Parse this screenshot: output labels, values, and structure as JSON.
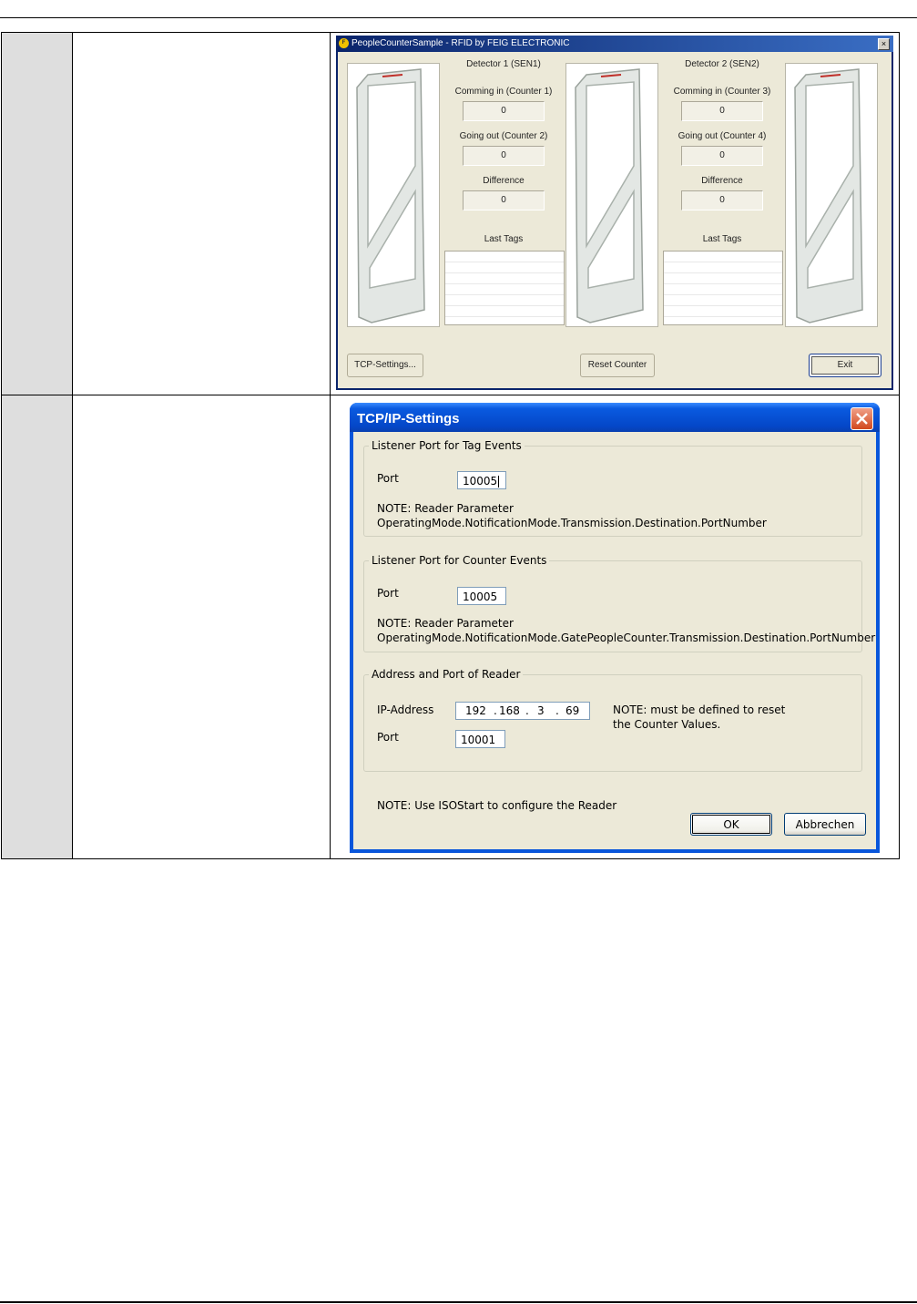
{
  "people_counter": {
    "title": "PeopleCounterSample - RFID by FEIG ELECTRONIC",
    "close_glyph": "×",
    "detectors": [
      {
        "name": "Detector 1 (SEN1)",
        "in_label": "Comming in (Counter 1)",
        "in_value": "0",
        "out_label": "Going out (Counter 2)",
        "out_value": "0",
        "diff_label": "Difference",
        "diff_value": "0",
        "tags_label": "Last Tags"
      },
      {
        "name": "Detector 2 (SEN2)",
        "in_label": "Comming in (Counter 3)",
        "in_value": "0",
        "out_label": "Going out (Counter 4)",
        "out_value": "0",
        "diff_label": "Difference",
        "diff_value": "0",
        "tags_label": "Last Tags"
      }
    ],
    "buttons": {
      "tcp_settings": "TCP-Settings...",
      "reset_counter": "Reset Counter",
      "exit": "Exit"
    }
  },
  "tcp_dialog": {
    "title": "TCP/IP-Settings",
    "tag_group": {
      "legend": "Listener Port for Tag Events",
      "port_label": "Port",
      "port_value": "10005",
      "note_line1": "NOTE: Reader Parameter",
      "note_line2": "OperatingMode.NotificationMode.Transmission.Destination.PortNumber"
    },
    "counter_group": {
      "legend": "Listener Port for Counter Events",
      "port_label": "Port",
      "port_value": "10005",
      "note_line1": "NOTE: Reader Parameter",
      "note_line2": "OperatingMode.NotificationMode.GatePeopleCounter.Transmission.Destination.PortNumber"
    },
    "reader_group": {
      "legend": "Address and Port of Reader",
      "ip_label": "IP-Address",
      "ip_octets": [
        "192",
        "168",
        "3",
        "69"
      ],
      "ip_separator": ".",
      "port_label": "Port",
      "port_value": "10001",
      "note_line1": "NOTE: must be defined to reset",
      "note_line2": "the Counter Values."
    },
    "footer_note": "NOTE: Use ISOStart to configure the Reader",
    "ok_label": "OK",
    "cancel_label": "Abbrechen"
  }
}
